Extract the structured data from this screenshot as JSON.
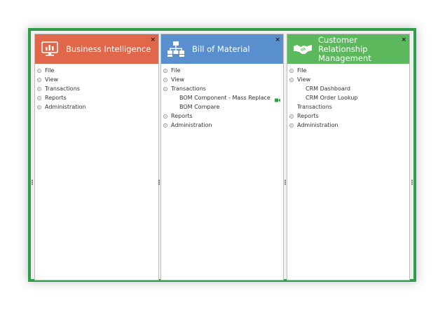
{
  "panels": [
    {
      "title": "Business Intelligence",
      "color": "#e0674a",
      "icon": "monitor-chart-icon",
      "items": [
        "File",
        "View",
        "Transactions",
        "Reports",
        "Administration"
      ]
    },
    {
      "title": "Bill of Material",
      "color": "#5a8fcf",
      "icon": "hierarchy-icon",
      "items": [
        "File",
        "View",
        "Transactions"
      ],
      "sub_items": [
        "BOM Component - Mass Replace",
        "BOM Compare"
      ],
      "items_after": [
        "Reports",
        "Administration"
      ]
    },
    {
      "title_line1": "Customer Relationship",
      "title_line2": "Management",
      "color": "#5cb85c",
      "icon": "handshake-icon",
      "items": [
        "File",
        "View"
      ],
      "sub_items": [
        "CRM Dashboard",
        "CRM Order Lookup"
      ],
      "plain_item": "Transactions",
      "items_after": [
        "Reports",
        "Administration"
      ]
    }
  ],
  "close_symbol": "×",
  "accent_frame": "#2f9e4a"
}
